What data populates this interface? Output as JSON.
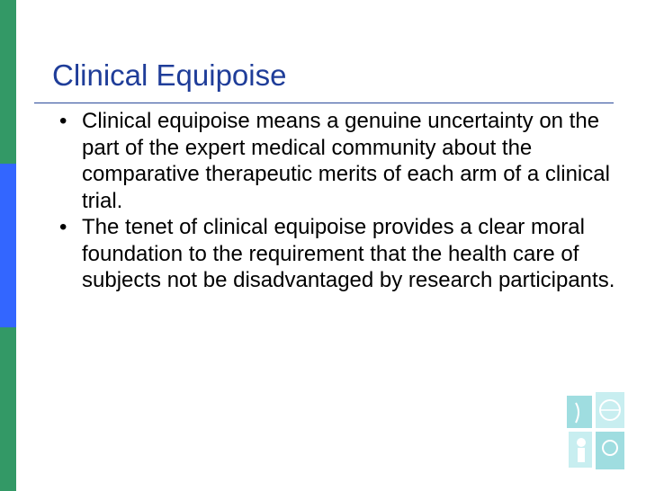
{
  "slide": {
    "title": "Clinical Equipoise",
    "bullet_symbol": "•",
    "bullets": [
      "Clinical equipoise means a genuine uncertainty on the part of the expert medical community about the comparative therapeutic merits of each arm of a clinical trial.",
      "The tenet of clinical equipoise provides a clear moral foundation to the requirement that the health care of subjects not be disadvantaged by research participants."
    ]
  },
  "colors": {
    "sidebar_green": "#339966",
    "sidebar_blue": "#3366ff",
    "title_blue": "#1f3d99",
    "rule_blue": "#2a4a9a",
    "logo_teal": "#9fdde0",
    "logo_light": "#c8eef0"
  },
  "logo": {
    "icon": "organization-logo-icon"
  }
}
